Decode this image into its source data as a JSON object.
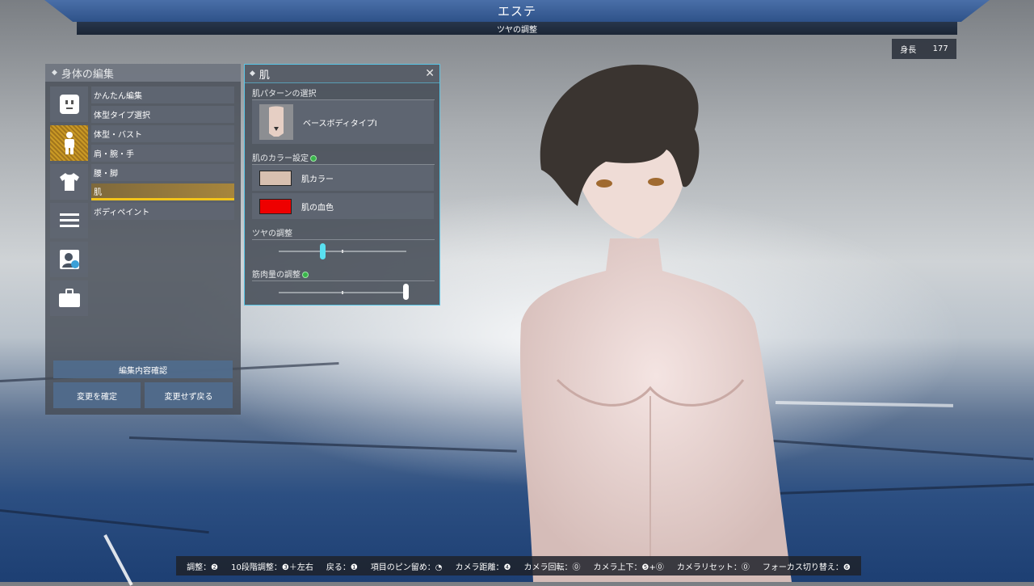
{
  "header": {
    "title": "エステ",
    "subtitle": "ツヤの調整"
  },
  "height_display": {
    "label": "身長",
    "value": "177"
  },
  "body_panel": {
    "title": "身体の編集",
    "category_icons": [
      "face-icon",
      "body-icon",
      "shirt-icon",
      "menu-icon",
      "profile-icon",
      "briefcase-icon"
    ],
    "menu_items": [
      "かんたん編集",
      "体型タイプ選択",
      "体型・バスト",
      "肩・腕・手",
      "腰・脚",
      "肌",
      "ボディペイント"
    ],
    "confirm_edit_label": "編集内容確認",
    "apply_label": "変更を確定",
    "discard_label": "変更せず戻る"
  },
  "skin_panel": {
    "title": "肌",
    "pattern_section": "肌パターンの選択",
    "pattern_value": "ベースボディタイプⅠ",
    "color_section": "肌のカラー設定",
    "skin_color_label": "肌カラー",
    "skin_color": "#d8c0b0",
    "blood_color_label": "肌の血色",
    "blood_color": "#ee0000",
    "gloss_section": "ツヤの調整",
    "gloss_value": 0.35,
    "muscle_section": "筋肉量の調整",
    "muscle_value": 1.0
  },
  "help": [
    "調整：❷",
    "10段階調整：❸＋左右",
    "戻る：❶",
    "項目のピン留め：◔",
    "カメラ距離：❹",
    "カメラ回転：⓪",
    "カメラ上下：❺+⓪",
    "カメラリセット：⓪",
    "フォーカス切り替え：❻"
  ],
  "colors": {
    "accent": "#59c6e6",
    "active": "#f2c41a",
    "knob": "#59e0f0"
  }
}
